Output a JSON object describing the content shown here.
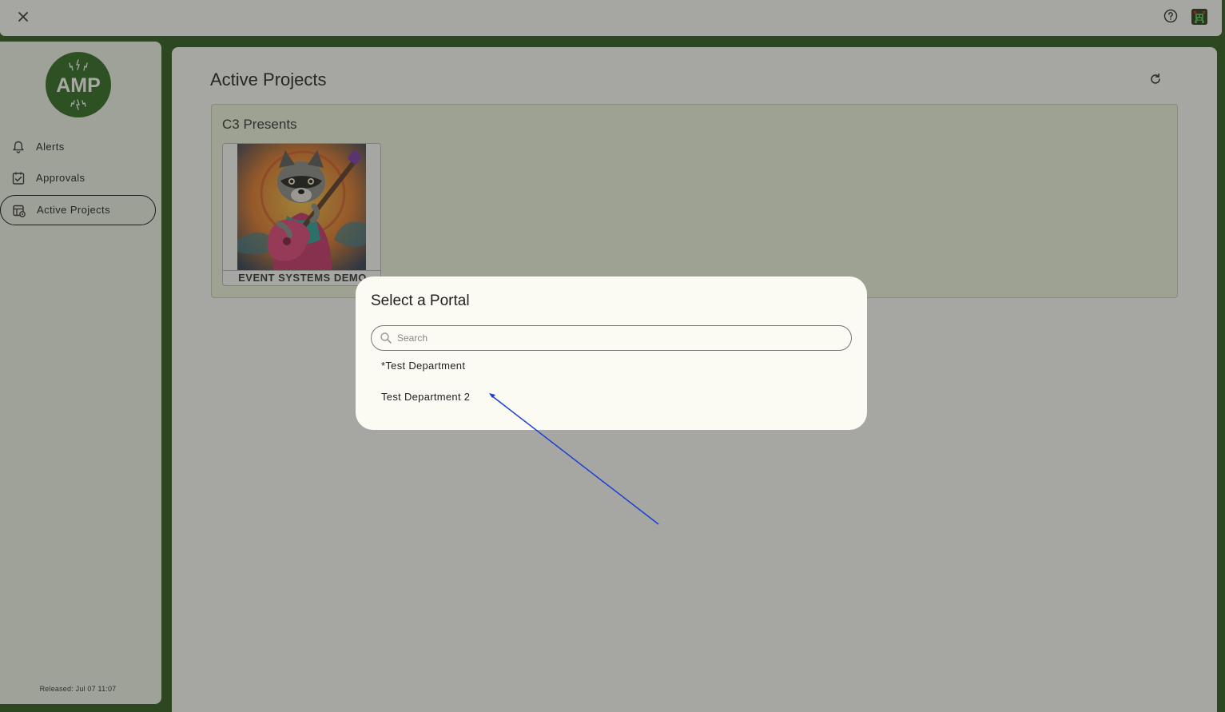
{
  "window": {
    "close_icon": "close-icon",
    "help_icon": "help-circle-icon",
    "avatar_icon": "user-avatar-icon"
  },
  "sidebar": {
    "logo_text": "AMP",
    "items": [
      {
        "label": "Alerts",
        "icon": "bell-icon"
      },
      {
        "label": "Approvals",
        "icon": "checklist-icon"
      },
      {
        "label": "Active Projects",
        "icon": "projects-icon",
        "active": true
      }
    ],
    "released": "Released: Jul 07 11:07"
  },
  "main": {
    "title": "Active Projects",
    "refresh_icon": "refresh-icon",
    "groups": [
      {
        "name": "C3 Presents",
        "projects": [
          {
            "name": "EVENT SYSTEMS DEMO",
            "image": "raccoon-guitar-artwork"
          }
        ]
      }
    ]
  },
  "dialog": {
    "title": "Select a Portal",
    "search_placeholder": "Search",
    "search_value": "",
    "items": [
      "*Test Department",
      "Test Department 2"
    ]
  },
  "colors": {
    "brand_green": "#2e6b22",
    "background_green": "#2d5a1e",
    "sidebar_bg": "#f2f6ec",
    "card_bg": "#eef6e0",
    "dialog_bg": "#fbfaf3",
    "annotation_arrow": "#1a3fd6"
  }
}
